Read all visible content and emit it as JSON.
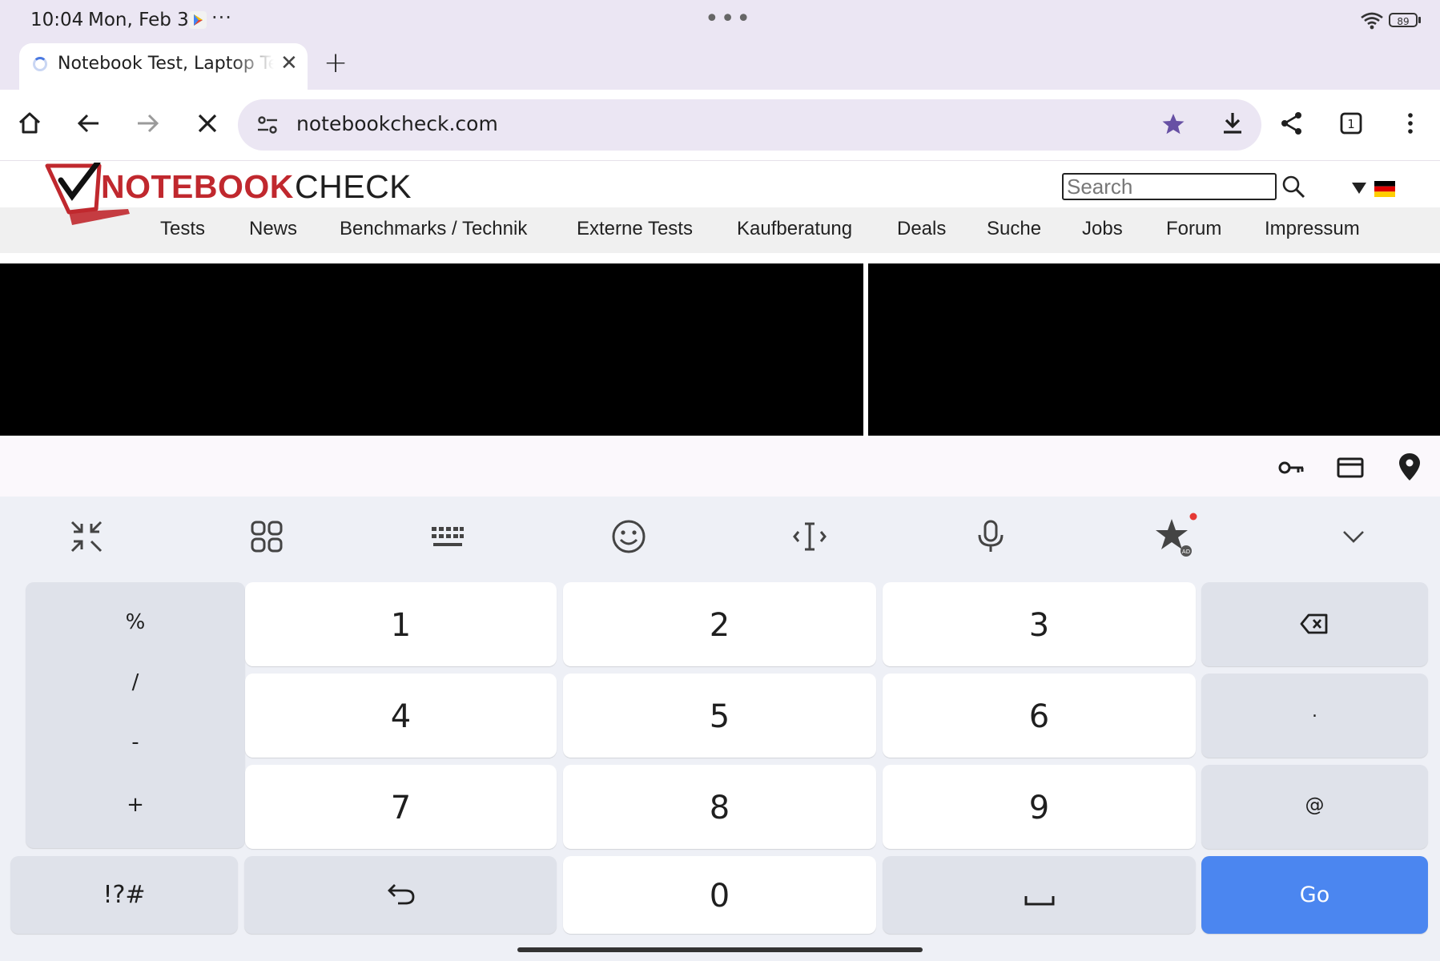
{
  "status_bar": {
    "time": "10:04",
    "date": "Mon, Feb 3",
    "more": "···",
    "center_dots": "•••",
    "battery": "89"
  },
  "tab": {
    "title": "Notebook Test, Laptop Test",
    "close": "✕",
    "new_tab": "+"
  },
  "omnibox": {
    "url": "notebookcheck.com"
  },
  "site": {
    "logo_part1": "NOTEBOOK",
    "logo_part2": "CHECK",
    "search_placeholder": "Search",
    "nav": [
      "Tests",
      "News",
      "Benchmarks / Technik",
      "Externe Tests",
      "Kaufberatung",
      "Deals",
      "Suche",
      "Jobs",
      "Forum",
      "Impressum"
    ]
  },
  "keyboard": {
    "symbols": [
      "%",
      "/",
      "-",
      "+"
    ],
    "digits": [
      "1",
      "2",
      "3",
      "4",
      "5",
      "6",
      "7",
      "8",
      "9",
      "0"
    ],
    "dot": ".",
    "at": "@",
    "sym_key": "!?#",
    "go": "Go"
  },
  "colors": {
    "accent_blue": "#4b86f0",
    "logo_red": "#c0282e",
    "star_purple": "#6750a4"
  }
}
